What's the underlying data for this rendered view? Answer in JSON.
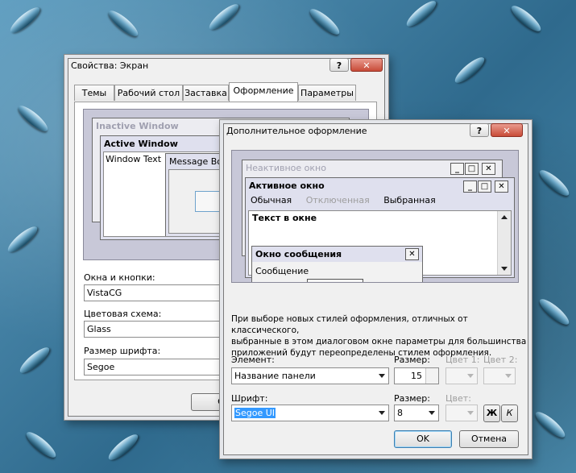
{
  "display_props": {
    "title": "Свойства: Экран",
    "help_btn": "?",
    "close_btn": "✕",
    "tabs": [
      "Темы",
      "Рабочий стол",
      "Заставка",
      "Оформление",
      "Параметры"
    ],
    "preview": {
      "inactive_window": "Inactive Window",
      "active_window": "Active Window",
      "window_text": "Window Text",
      "message_box": "Message Bo"
    },
    "windows_buttons_label": "Окна и кнопки:",
    "windows_buttons_value": "VistaCG",
    "color_scheme_label": "Цветовая схема:",
    "color_scheme_value": "Glass",
    "font_size_label": "Размер шрифта:",
    "font_size_value": "Segoe",
    "ok_fragment": "O"
  },
  "advanced": {
    "title": "Дополнительное оформление",
    "help_btn": "?",
    "close_btn": "✕",
    "preview": {
      "inactive_window": "Неактивное окно",
      "active_window": "Активное окно",
      "menu": [
        "Обычная",
        "Отключенная",
        "Выбранная"
      ],
      "window_text": "Текст в окне",
      "message_title": "Окно сообщения",
      "message_text": "Сообщение",
      "message_ok": "OK",
      "min_glyph": "_",
      "max_glyph": "□",
      "close_glyph": "✕"
    },
    "description": [
      "При выборе новых стилей оформления, отличных от классического,",
      "выбранные в этом диалоговом окне параметры для большинства",
      "приложений будут переопределены стилем оформления."
    ],
    "element_label": "Элемент:",
    "element_value": "Название панели",
    "size_label": "Размер:",
    "size_value": "15",
    "color1_label": "Цвет 1:",
    "color2_label": "Цвет 2:",
    "font_label": "Шрифт:",
    "font_value": "Segoe UI",
    "font_size_label": "Размер:",
    "font_size_value": "8",
    "font_color_label": "Цвет:",
    "bold_btn": "Ж",
    "italic_btn": "К",
    "ok_btn": "OK",
    "cancel_btn": "Отмена"
  },
  "colors": {
    "desktop": "#3f7fa2",
    "selection": "#3399ff",
    "preview_bg": "#c8c8d8",
    "active_caption": "#dfe0ee"
  }
}
